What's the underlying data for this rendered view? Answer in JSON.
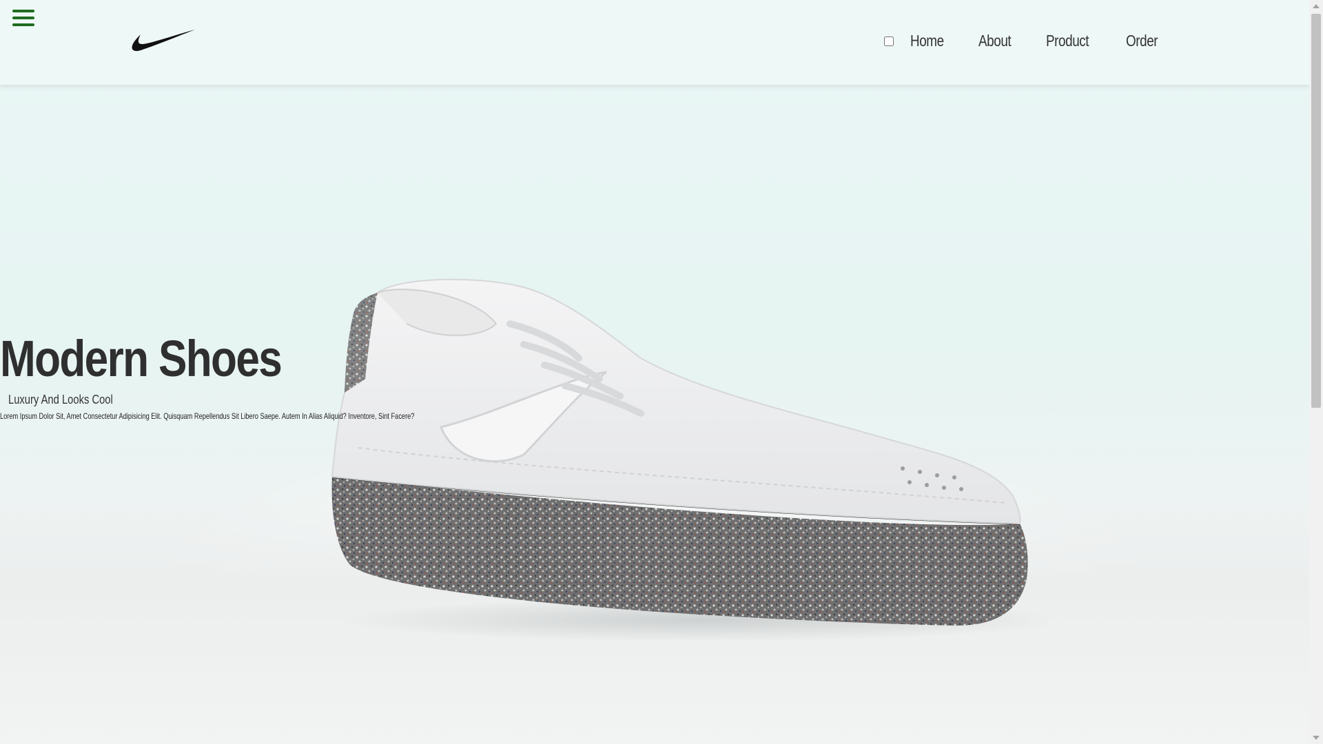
{
  "header": {
    "logo_icon": "nike-swoosh-icon",
    "menu_icon": "hamburger-menu-icon",
    "nav": {
      "items": [
        {
          "label": "Home"
        },
        {
          "label": "About"
        },
        {
          "label": "Product"
        },
        {
          "label": "Order"
        }
      ]
    }
  },
  "hero": {
    "title": "Modern Shoes",
    "subtitle": "Luxury And Looks Cool",
    "description": "Lorem Ipsum Dolor Sit, Amet Consectetur Adipisicing Elit. Quisquam Repellendus Sit Libero Saepe. Autem In Alias Aliquid? Inventore, Sint Facere?",
    "image_icon": "sneaker-image"
  },
  "colors": {
    "menu_icon": "#1e6b1e",
    "header_bg": "#eef8f6",
    "text": "#333333"
  }
}
